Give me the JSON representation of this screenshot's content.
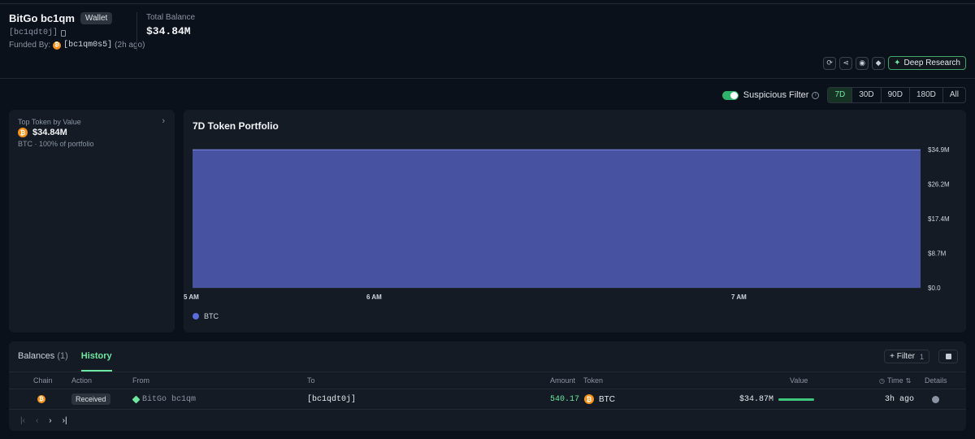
{
  "header": {
    "wallet_name": "BitGo bc1qm",
    "wallet_badge": "Wallet",
    "address": "[bc1qdt0j]",
    "funded_by_label": "Funded By:",
    "funded_by_address": "[bc1qm0s5]",
    "funded_by_time": "(2h ago)",
    "total_balance_label": "Total Balance",
    "total_balance_value": "$34.84M",
    "deep_research_label": "Deep Research"
  },
  "controls": {
    "suspicious_filter_label": "Suspicious Filter",
    "ranges": [
      "7D",
      "30D",
      "90D",
      "180D",
      "All"
    ],
    "active_range": "7D"
  },
  "top_token": {
    "label": "Top Token by Value",
    "value": "$34.84M",
    "sub": "BTC · 100% of portfolio"
  },
  "chart_data": {
    "type": "area",
    "title": "7D Token Portfolio",
    "x_ticks": [
      "5 AM",
      "6 AM",
      "7 AM"
    ],
    "y_ticks": [
      "$0.0",
      "$8.7M",
      "$17.4M",
      "$26.2M",
      "$34.9M"
    ],
    "ylim": [
      0,
      34.9
    ],
    "y_unit": "$M",
    "series": [
      {
        "name": "BTC",
        "color": "#4a55a8",
        "values": [
          34.84,
          34.84,
          34.84,
          34.84
        ]
      }
    ],
    "grid": true,
    "legend_position": "bottom-left"
  },
  "table": {
    "tabs": [
      {
        "label": "Balances",
        "count": "(1)"
      },
      {
        "label": "History",
        "count": ""
      }
    ],
    "active_tab": "History",
    "filter_label": "+ Filter",
    "filter_count": "1",
    "columns": [
      "Chain",
      "Action",
      "From",
      "To",
      "Amount",
      "Token",
      "Value",
      "Time",
      "Details"
    ],
    "rows": [
      {
        "chain_icon": "bitcoin-icon",
        "action": "Received",
        "from": "BitGo bc1qm",
        "to": "[bc1qdt0j]",
        "amount": "540.17",
        "token": "BTC",
        "value": "$34.87M",
        "time": "3h ago"
      }
    ]
  },
  "colors": {
    "accent_green": "#6ee7a0",
    "area_fill": "#4a55a8",
    "bitcoin": "#f7931a"
  }
}
